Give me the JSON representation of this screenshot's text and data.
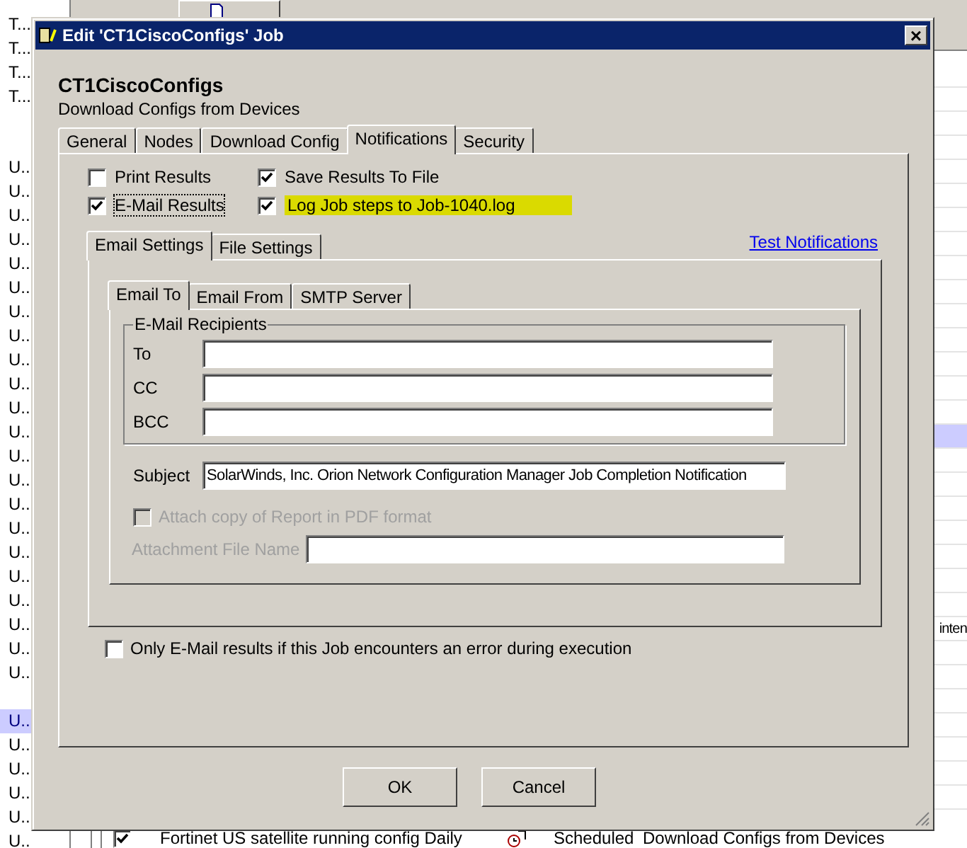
{
  "background": {
    "left_groups": [
      [
        {
          "label": "T...",
          "selected": false
        },
        {
          "label": "T...",
          "selected": false
        },
        {
          "label": "T...",
          "selected": false
        },
        {
          "label": "T...",
          "selected": false
        }
      ],
      [
        {
          "label": "U..",
          "selected": false
        },
        {
          "label": "U..",
          "selected": false
        },
        {
          "label": "U..",
          "selected": false
        },
        {
          "label": "U..",
          "selected": false
        },
        {
          "label": "U..",
          "selected": false
        },
        {
          "label": "U..",
          "selected": false
        },
        {
          "label": "U..",
          "selected": false
        },
        {
          "label": "U..",
          "selected": false
        },
        {
          "label": "U..",
          "selected": false
        },
        {
          "label": "U..",
          "selected": false
        },
        {
          "label": "U..",
          "selected": false
        },
        {
          "label": "U..",
          "selected": false
        },
        {
          "label": "U..",
          "selected": false
        },
        {
          "label": "U..",
          "selected": false
        },
        {
          "label": "U..",
          "selected": false
        },
        {
          "label": "U..",
          "selected": false
        },
        {
          "label": "U..",
          "selected": false
        },
        {
          "label": "U..",
          "selected": false
        },
        {
          "label": "U..",
          "selected": false
        },
        {
          "label": "U..",
          "selected": false
        },
        {
          "label": "U..",
          "selected": false
        },
        {
          "label": "U..",
          "selected": false
        }
      ],
      [
        {
          "label": "U..",
          "selected": true
        },
        {
          "label": "U..",
          "selected": false
        },
        {
          "label": "U..",
          "selected": false
        },
        {
          "label": "U..",
          "selected": false
        },
        {
          "label": "U..",
          "selected": false
        },
        {
          "label": "U..",
          "selected": false
        }
      ]
    ],
    "list_rows": [
      {
        "selected": false
      },
      {
        "selected": false
      },
      {
        "selected": false
      },
      {
        "selected": false
      },
      {
        "selected": false
      },
      {
        "selected": false
      },
      {
        "selected": false
      },
      {
        "selected": false
      },
      {
        "selected": false
      },
      {
        "selected": false
      },
      {
        "selected": false
      },
      {
        "selected": false
      },
      {
        "selected": false
      },
      {
        "selected": false
      },
      {
        "selected": false
      },
      {
        "selected": true
      },
      {
        "selected": false
      },
      {
        "selected": false
      },
      {
        "selected": false
      },
      {
        "selected": false
      },
      {
        "selected": false
      },
      {
        "selected": false
      },
      {
        "selected": false
      },
      {
        "selected": false,
        "text": "inten"
      },
      {
        "selected": false
      },
      {
        "selected": false
      },
      {
        "selected": false
      },
      {
        "selected": false
      },
      {
        "selected": false
      },
      {
        "selected": false
      },
      {
        "selected": false
      }
    ],
    "bottom_row": {
      "checked": true,
      "name": "Fortinet US satellite running config Daily",
      "status": "Scheduled",
      "job_type": "Download Configs from Devices"
    }
  },
  "dialog": {
    "title": "Edit 'CT1CiscoConfigs' Job",
    "close": "×",
    "job_name": "CT1CiscoConfigs",
    "description": "Download Configs from Devices",
    "tabs": [
      {
        "label": "General",
        "selected": false
      },
      {
        "label": "Nodes",
        "selected": false
      },
      {
        "label": "Download Config",
        "selected": false
      },
      {
        "label": "Notifications",
        "selected": true
      },
      {
        "label": "Security",
        "selected": false
      }
    ],
    "options": [
      {
        "label": "Print Results",
        "checked": false,
        "highlighted": false,
        "focused": false
      },
      {
        "label": "Save Results To File",
        "checked": true,
        "highlighted": false,
        "focused": false
      },
      {
        "label": "E-Mail Results",
        "checked": true,
        "highlighted": false,
        "focused": true
      },
      {
        "label": "Log Job steps to Job-1040.log",
        "checked": true,
        "highlighted": true,
        "focused": false
      }
    ],
    "settings_tabs": [
      {
        "label": "Email Settings",
        "selected": true
      },
      {
        "label": "File Settings",
        "selected": false
      }
    ],
    "test_link": "Test Notifications",
    "email_tabs": [
      {
        "label": "Email To",
        "selected": true
      },
      {
        "label": "Email From",
        "selected": false
      },
      {
        "label": "SMTP Server",
        "selected": false
      }
    ],
    "recipients_title": "E-Mail Recipients",
    "recipients": [
      {
        "label": "To"
      },
      {
        "label": "CC"
      },
      {
        "label": "BCC"
      }
    ],
    "subject": {
      "label": "Subject",
      "value": "SolarWinds, Inc. Orion Network Configuration Manager Job Completion Notification"
    },
    "attach_pdf": {
      "label": "Attach copy of Report in PDF format",
      "checked": false,
      "disabled": true
    },
    "attachment_name": {
      "label": "Attachment File Name",
      "disabled": true
    },
    "only_errors": {
      "label": "Only E-Mail results if this Job encounters an error during execution",
      "checked": false
    },
    "buttons": [
      "OK",
      "Cancel"
    ]
  }
}
